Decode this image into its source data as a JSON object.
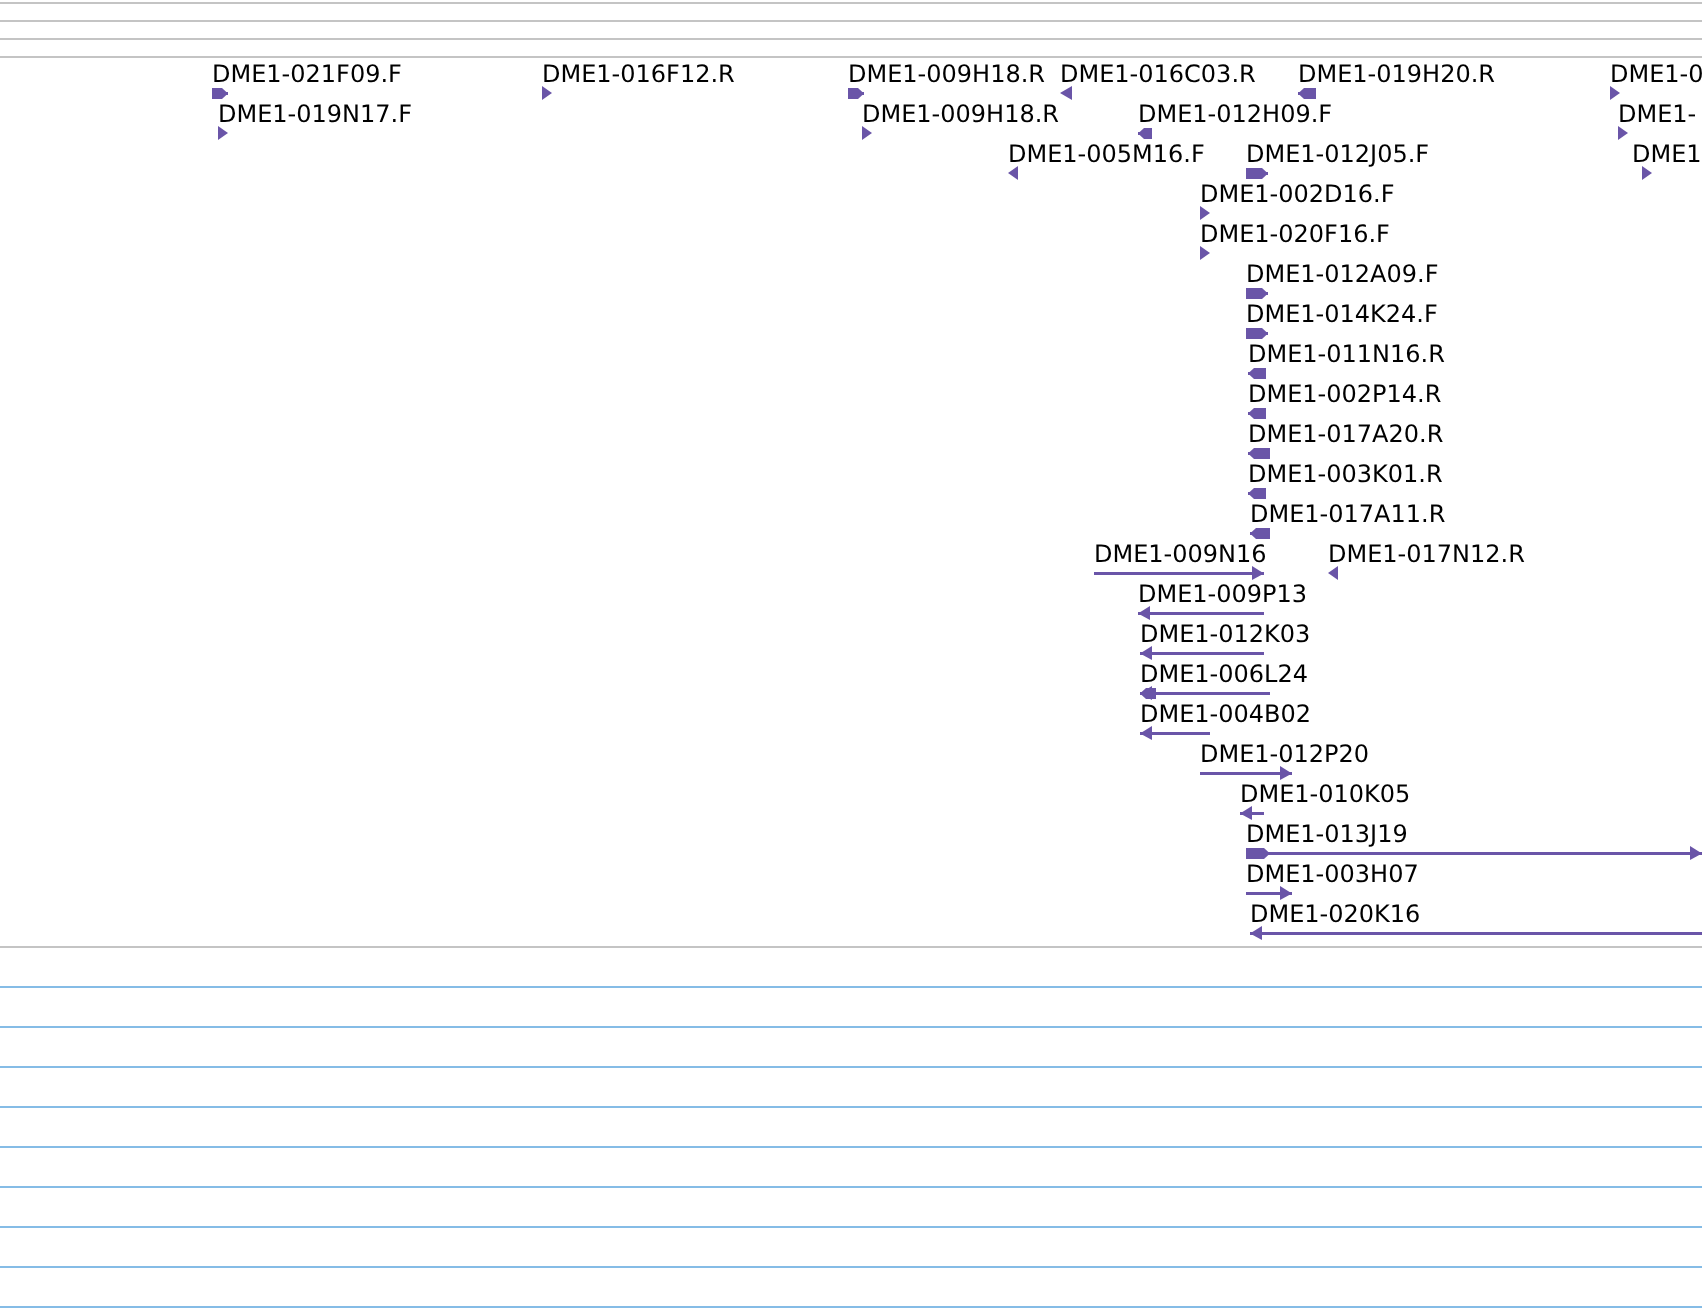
{
  "track": {
    "features": [
      {
        "label": "DME1-021F09.F",
        "reverse": false
      },
      {
        "label": "DME1-016F12.R",
        "reverse": false
      },
      {
        "label": "DME1-009H18.R",
        "reverse": false
      },
      {
        "label": "DME1-016C03.R",
        "reverse": true
      },
      {
        "label": "DME1-019H20.R",
        "reverse": true
      },
      {
        "label": "DME1-0",
        "reverse": false
      },
      {
        "label": "DME1-019N17.F",
        "reverse": false
      },
      {
        "label": "DME1-009H18.R",
        "reverse": false
      },
      {
        "label": "DME1-012H09.F",
        "reverse": true
      },
      {
        "label": "DME1-",
        "reverse": false
      },
      {
        "label": "DME1-005M16.F",
        "reverse": true
      },
      {
        "label": "DME1-012J05.F",
        "reverse": false
      },
      {
        "label": "DME1",
        "reverse": false
      },
      {
        "label": "DME1-002D16.F",
        "reverse": false
      },
      {
        "label": "DME1-020F16.F",
        "reverse": false
      },
      {
        "label": "DME1-012A09.F",
        "reverse": false
      },
      {
        "label": "DME1-014K24.F",
        "reverse": false
      },
      {
        "label": "DME1-011N16.R",
        "reverse": true
      },
      {
        "label": "DME1-002P14.R",
        "reverse": true
      },
      {
        "label": "DME1-017A20.R",
        "reverse": true
      },
      {
        "label": "DME1-003K01.R",
        "reverse": true
      },
      {
        "label": "DME1-017A11.R",
        "reverse": true
      },
      {
        "label": "DME1-009N16",
        "reverse": false
      },
      {
        "label": "DME1-017N12.R",
        "reverse": true
      },
      {
        "label": "DME1-009P13",
        "reverse": true
      },
      {
        "label": "DME1-012K03",
        "reverse": true
      },
      {
        "label": "DME1-006L24",
        "reverse": true
      },
      {
        "label": "DME1-004B02",
        "reverse": true
      },
      {
        "label": "DME1-012P20",
        "reverse": false
      },
      {
        "label": "DME1-010K05",
        "reverse": true
      },
      {
        "label": "DME1-013J19",
        "reverse": false
      },
      {
        "label": "DME1-003H07",
        "reverse": false
      },
      {
        "label": "DME1-020K16",
        "reverse": true
      }
    ]
  }
}
